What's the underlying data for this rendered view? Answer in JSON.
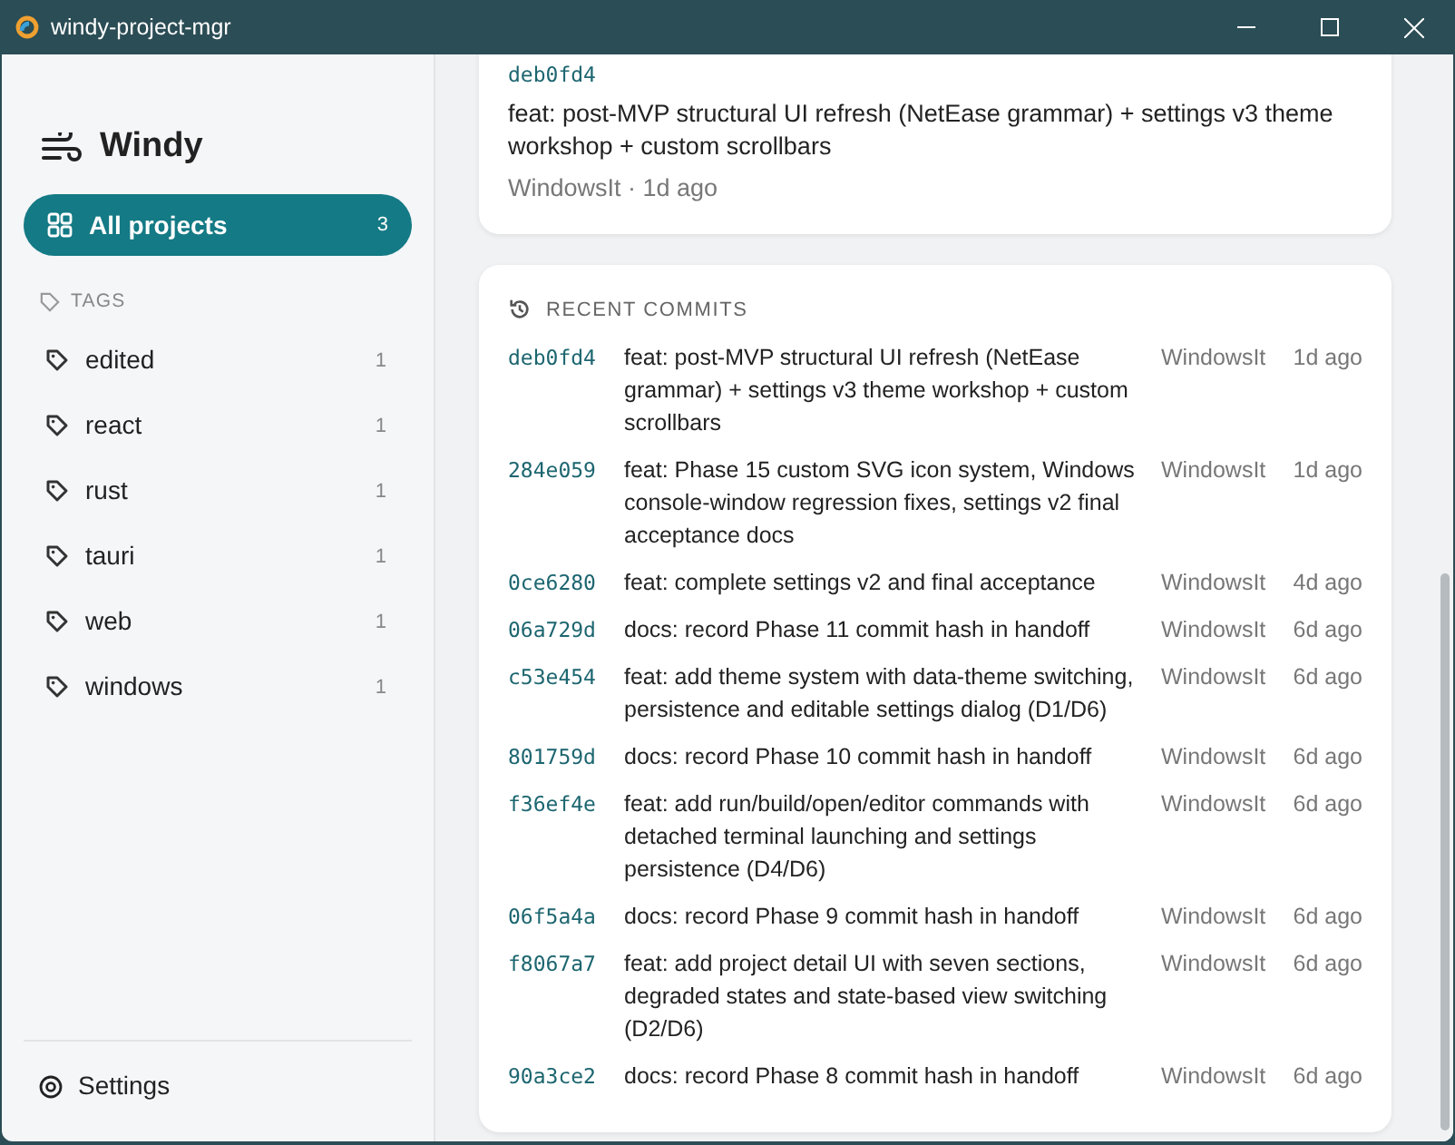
{
  "window": {
    "title": "windy-project-mgr"
  },
  "sidebar": {
    "brand": "Windy",
    "nav": [
      {
        "label": "All projects",
        "count": "3",
        "selected": true
      }
    ],
    "tags_heading": "TAGS",
    "tags": [
      {
        "label": "edited",
        "count": "1",
        "selected": false
      },
      {
        "label": "react",
        "count": "1",
        "selected": false
      },
      {
        "label": "rust",
        "count": "1",
        "selected": false
      },
      {
        "label": "tauri",
        "count": "1",
        "selected": false
      },
      {
        "label": "web",
        "count": "1",
        "selected": false
      },
      {
        "label": "windows",
        "count": "1",
        "selected": false
      }
    ],
    "settings": "Settings"
  },
  "latest_commit": {
    "hash": "deb0fd4",
    "message": "feat: post-MVP structural UI refresh (NetEase grammar) + settings v3 theme workshop + custom scrollbars",
    "meta": "WindowsIt · 1d ago"
  },
  "recent_commits": {
    "heading": "RECENT COMMITS",
    "rows": [
      {
        "hash": "deb0fd4",
        "message": "feat: post-MVP structural UI refresh (NetEase grammar) + settings v3 theme workshop + custom scrollbars",
        "author": "WindowsIt",
        "time": "1d ago"
      },
      {
        "hash": "284e059",
        "message": "feat: Phase 15 custom SVG icon system, Windows console-window regression fixes, settings v2 final acceptance docs",
        "author": "WindowsIt",
        "time": "1d ago"
      },
      {
        "hash": "0ce6280",
        "message": "feat: complete settings v2 and final acceptance",
        "author": "WindowsIt",
        "time": "4d ago"
      },
      {
        "hash": "06a729d",
        "message": "docs: record Phase 11 commit hash in handoff",
        "author": "WindowsIt",
        "time": "6d ago"
      },
      {
        "hash": "c53e454",
        "message": "feat: add theme system with data-theme switching, persistence and editable settings dialog (D1/D6)",
        "author": "WindowsIt",
        "time": "6d ago"
      },
      {
        "hash": "801759d",
        "message": "docs: record Phase 10 commit hash in handoff",
        "author": "WindowsIt",
        "time": "6d ago"
      },
      {
        "hash": "f36ef4e",
        "message": "feat: add run/build/open/editor commands with detached terminal launching and settings persistence (D4/D6)",
        "author": "WindowsIt",
        "time": "6d ago"
      },
      {
        "hash": "06f5a4a",
        "message": "docs: record Phase 9 commit hash in handoff",
        "author": "WindowsIt",
        "time": "6d ago"
      },
      {
        "hash": "f8067a7",
        "message": "feat: add project detail UI with seven sections, degraded states and state-based view switching (D2/D6)",
        "author": "WindowsIt",
        "time": "6d ago"
      },
      {
        "hash": "90a3ce2",
        "message": "docs: record Phase 8 commit hash in handoff",
        "author": "WindowsIt",
        "time": "6d ago"
      }
    ]
  }
}
